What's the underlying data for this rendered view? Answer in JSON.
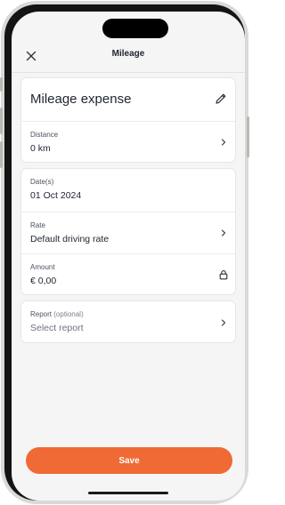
{
  "header": {
    "title": "Mileage",
    "close_icon": "close-icon"
  },
  "expense": {
    "title": "Mileage expense",
    "edit_icon": "pencil-icon"
  },
  "distance": {
    "label": "Distance",
    "value": "0 km"
  },
  "date": {
    "label": "Date(s)",
    "value": "01 Oct 2024"
  },
  "rate": {
    "label": "Rate",
    "value": "Default driving rate"
  },
  "amount": {
    "label": "Amount",
    "value": "€ 0,00",
    "icon": "lock-icon"
  },
  "report": {
    "label": "Report",
    "optional": "(optional)",
    "placeholder": "Select report"
  },
  "save": {
    "label": "Save"
  },
  "colors": {
    "accent": "#ef6a34",
    "background": "#f5f5f5",
    "card": "#ffffff",
    "text": "#1f2430"
  }
}
